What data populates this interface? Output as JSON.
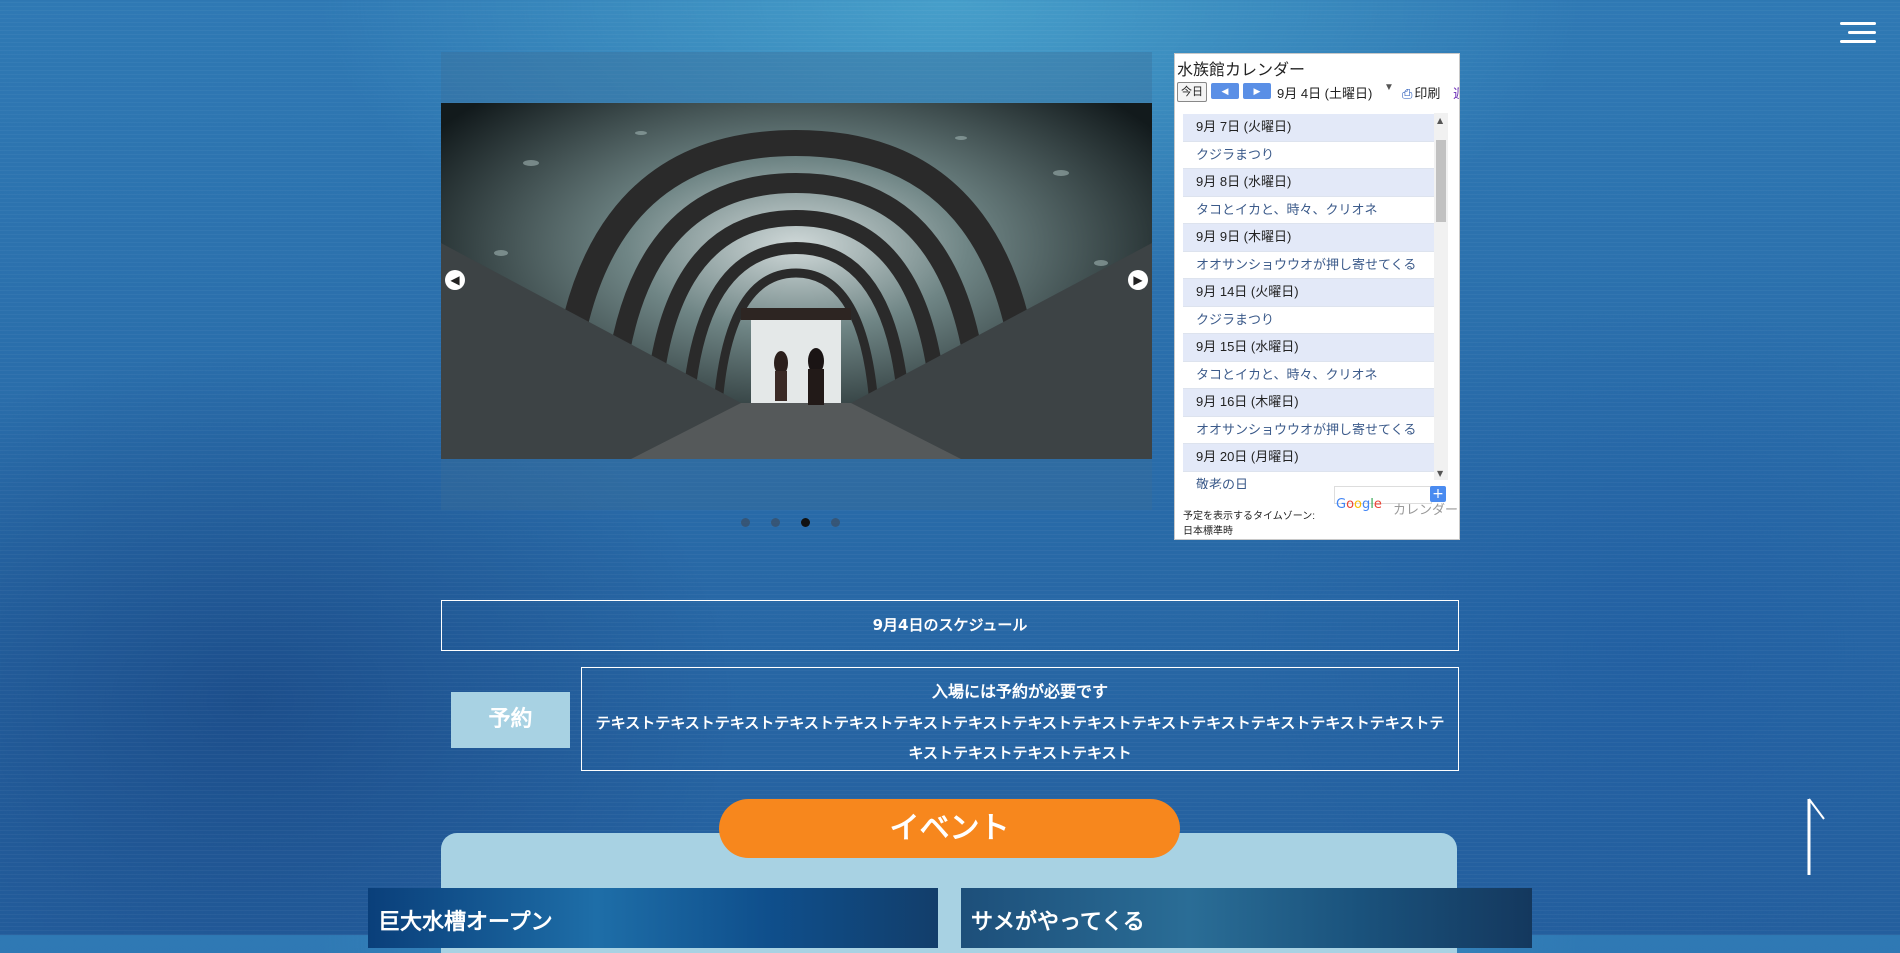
{
  "calendar": {
    "title": "水族館カレンダー",
    "today_label": "今日",
    "current_date": "9月 4日 (土曜日)",
    "print_label": "印刷",
    "more_label": "週",
    "rows": [
      {
        "type": "day",
        "text": "9月 7日 (火曜日)"
      },
      {
        "type": "ev",
        "text": "クジラまつり"
      },
      {
        "type": "day",
        "text": "9月 8日 (水曜日)"
      },
      {
        "type": "ev",
        "text": "タコとイカと、時々、クリオネ"
      },
      {
        "type": "day",
        "text": "9月 9日 (木曜日)"
      },
      {
        "type": "ev",
        "text": "オオサンショウウオが押し寄せてくる"
      },
      {
        "type": "day",
        "text": "9月 14日 (火曜日)"
      },
      {
        "type": "ev",
        "text": "クジラまつり"
      },
      {
        "type": "day",
        "text": "9月 15日 (水曜日)"
      },
      {
        "type": "ev",
        "text": "タコとイカと、時々、クリオネ"
      },
      {
        "type": "day",
        "text": "9月 16日 (木曜日)"
      },
      {
        "type": "ev",
        "text": "オオサンショウウオが押し寄せてくる"
      },
      {
        "type": "day",
        "text": "9月 20日 (月曜日)"
      },
      {
        "type": "ev",
        "text": "敬老の日"
      }
    ],
    "timezone_label": "予定を表示するタイムゾーン:",
    "timezone_value": "日本標準時",
    "google_calendar_label": "カレンダー"
  },
  "slider": {
    "dot_count": 4,
    "active_index": 2
  },
  "schedule": {
    "label": "9月4日のスケジュール"
  },
  "reservation": {
    "button_label": "予約",
    "heading": "入場には予約が必要です",
    "body": "テキストテキストテキストテキストテキストテキストテキストテキストテキストテキストテキストテキストテキストテキストテキストテキストテキストテキスト"
  },
  "events": {
    "section_title": "イベント",
    "cards": [
      {
        "title": "巨大水槽オープン"
      },
      {
        "title": "サメがやってくる"
      }
    ]
  },
  "colors": {
    "accent": "#f7871d",
    "panel": "#a8d2e3",
    "background": "#2a6eab"
  }
}
